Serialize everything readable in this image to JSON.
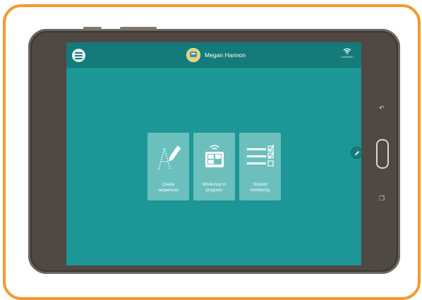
{
  "app": {
    "user_name": "Megan Hannon",
    "network_label": "LADWIFI"
  },
  "tiles": [
    {
      "label": "Create\nsequences",
      "icon": "pencil-letter-icon"
    },
    {
      "label": "Workshop in\nprogress",
      "icon": "tablet-wifi-icon"
    },
    {
      "label": "Student\nmonitoring",
      "icon": "checklist-icon"
    }
  ],
  "colors": {
    "frame": "#f39a2e",
    "screen": "#1c9696",
    "topbar": "#147b7a",
    "tile": "#6bc0be",
    "bezel": "#4f4843"
  }
}
